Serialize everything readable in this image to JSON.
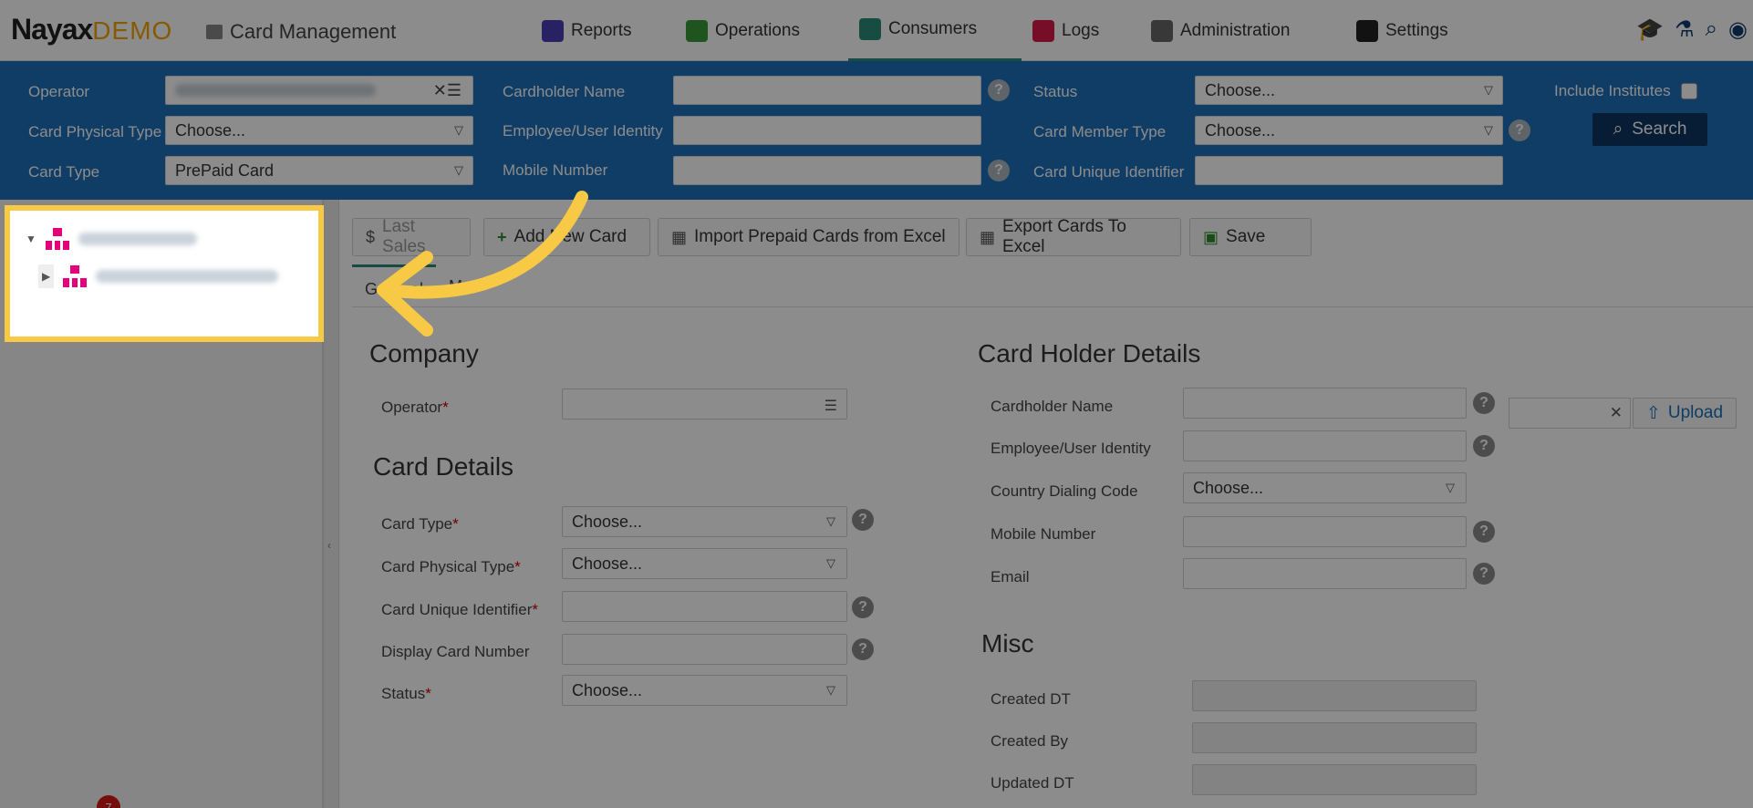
{
  "header": {
    "logo_brand": "Nayax",
    "logo_demo": "DEMO",
    "app_title": "Card Management",
    "nav": [
      {
        "label": "Reports",
        "icon": "reports-icon",
        "color": "#4a3fb8"
      },
      {
        "label": "Operations",
        "icon": "operations-icon",
        "color": "#3a9a3a"
      },
      {
        "label": "Consumers",
        "icon": "consumers-icon",
        "color": "#2a8a7a"
      },
      {
        "label": "Logs",
        "icon": "logs-icon",
        "color": "#d81b4a"
      },
      {
        "label": "Administration",
        "icon": "administration-icon",
        "color": "#666666"
      },
      {
        "label": "Settings",
        "icon": "settings-icon",
        "color": "#222222"
      }
    ],
    "active_nav": "Consumers",
    "right_icons": [
      "graduation-cap-icon",
      "flask-icon",
      "search-icon",
      "globe-icon"
    ]
  },
  "filters": {
    "operator_label": "Operator",
    "card_physical_type_label": "Card Physical Type",
    "card_physical_type_value": "Choose...",
    "card_type_label": "Card Type",
    "card_type_value": "PrePaid Card",
    "cardholder_name_label": "Cardholder Name",
    "employee_identity_label": "Employee/User Identity",
    "mobile_number_label": "Mobile Number",
    "status_label": "Status",
    "status_value": "Choose...",
    "card_member_type_label": "Card Member Type",
    "card_member_type_value": "Choose...",
    "card_unique_identifier_label": "Card Unique Identifier",
    "include_institutes_label": "Include Institutes",
    "search_label": "Search"
  },
  "toolbar": {
    "last_sales": "Last Sales",
    "add_new_card": "Add New Card",
    "import_prepaid": "Import Prepaid Cards from Excel",
    "export_cards": "Export Cards To Excel",
    "save": "Save"
  },
  "tabs": [
    "General",
    "M"
  ],
  "company": {
    "title": "Company",
    "operator_label": "Operator"
  },
  "card_details": {
    "title": "Card Details",
    "card_type_label": "Card Type",
    "card_type_value": "Choose...",
    "card_physical_type_label": "Card Physical Type",
    "card_physical_type_value": "Choose...",
    "card_unique_identifier_label": "Card Unique Identifier",
    "display_card_number_label": "Display Card Number",
    "status_label": "Status",
    "status_value": "Choose..."
  },
  "card_holder": {
    "title": "Card Holder Details",
    "cardholder_name_label": "Cardholder Name",
    "employee_identity_label": "Employee/User Identity",
    "country_dialing_code_label": "Country Dialing Code",
    "country_dialing_code_value": "Choose...",
    "mobile_number_label": "Mobile Number",
    "email_label": "Email",
    "upload_label": "Upload"
  },
  "misc": {
    "title": "Misc",
    "created_dt_label": "Created DT",
    "created_by_label": "Created By",
    "updated_dt_label": "Updated DT"
  },
  "notification_count": "7",
  "highlight_color": "#f7c945"
}
